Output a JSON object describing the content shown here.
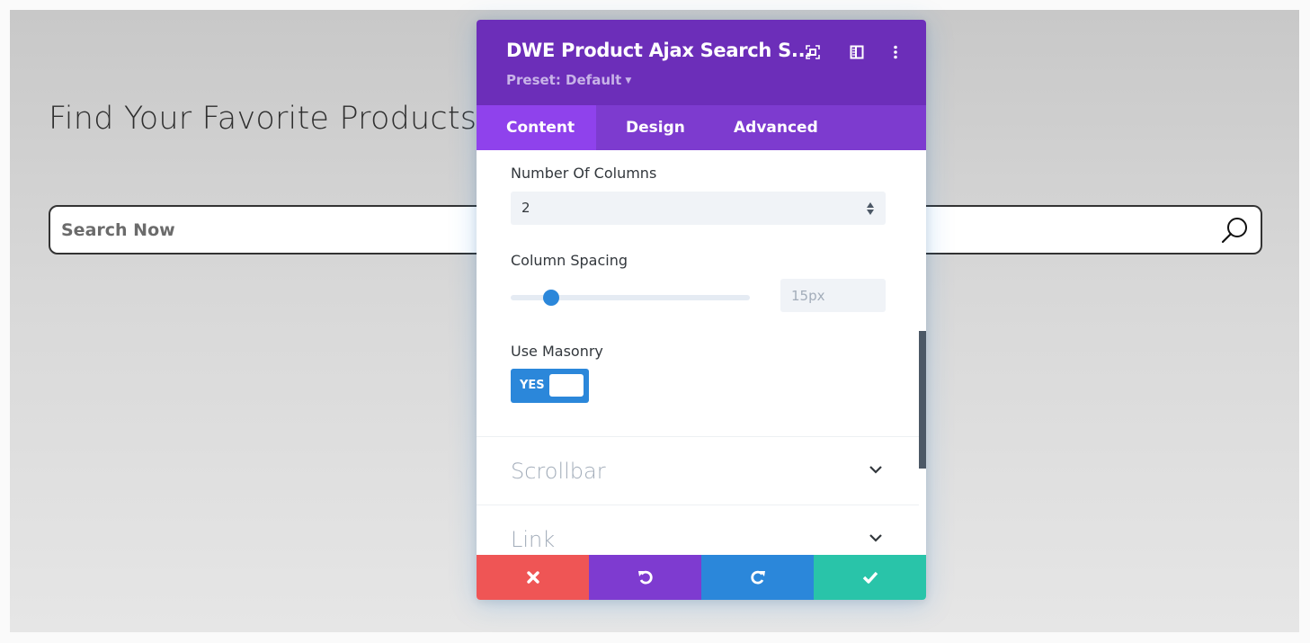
{
  "page": {
    "headline": "Find Your Favorite Products",
    "search": {
      "placeholder": "Search Now",
      "value": "",
      "icon": "search-icon"
    }
  },
  "modal": {
    "title": "DWE Product Ajax Search S...",
    "preset_label": "Preset: Default",
    "header_icons": [
      "focus-mode-icon",
      "sidebar-layout-icon",
      "more-options-icon"
    ],
    "tabs": [
      {
        "label": "Content",
        "active": true
      },
      {
        "label": "Design",
        "active": false
      },
      {
        "label": "Advanced",
        "active": false
      }
    ],
    "fields": {
      "number_of_columns": {
        "label": "Number Of Columns",
        "value": "2"
      },
      "column_spacing": {
        "label": "Column Spacing",
        "value": "15px",
        "slider_percent": 17
      },
      "use_masonry": {
        "label": "Use Masonry",
        "value": "YES",
        "enabled": true
      }
    },
    "sections": [
      {
        "title": "Scrollbar",
        "icon": "chevron-down-icon"
      },
      {
        "title": "Link",
        "icon": "chevron-down-icon"
      }
    ],
    "footer": {
      "cancel_icon": "close-icon",
      "undo_icon": "undo-icon",
      "redo_icon": "redo-icon",
      "save_icon": "check-icon"
    },
    "colors": {
      "header": "#6c2eb9",
      "tab_bar": "#7d3bcf",
      "tab_active": "#8f42ec",
      "accent_blue": "#2b87da",
      "cancel": "#ef5555",
      "undo": "#7e3bd0",
      "redo": "#2b87da",
      "save": "#29c4a9"
    }
  }
}
